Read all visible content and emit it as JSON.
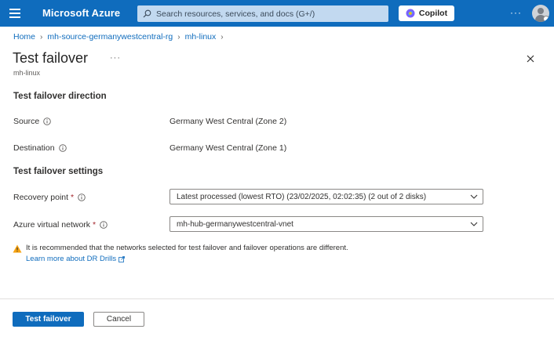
{
  "topbar": {
    "brand": "Microsoft Azure",
    "search_placeholder": "Search resources, services, and docs (G+/)",
    "copilot_label": "Copilot",
    "more_label": "···"
  },
  "breadcrumb": [
    {
      "label": "Home"
    },
    {
      "label": "mh-source-germanywestcentral-rg"
    },
    {
      "label": "mh-linux"
    }
  ],
  "page": {
    "title": "Test failover",
    "more": "···",
    "subtitle": "mh-linux"
  },
  "direction": {
    "heading": "Test failover direction",
    "source_label": "Source",
    "source_value": "Germany West Central (Zone 2)",
    "destination_label": "Destination",
    "destination_value": "Germany West Central (Zone 1)"
  },
  "settings": {
    "heading": "Test failover settings",
    "recovery_point_label": "Recovery point",
    "recovery_point_value": "Latest processed (lowest RTO) (23/02/2025, 02:02:35) (2 out of 2 disks)",
    "vnet_label": "Azure virtual network",
    "vnet_value": "mh-hub-germanywestcentral-vnet",
    "required_marker": "*"
  },
  "warning": {
    "text": "It is recommended that the networks selected for test failover and failover operations are different.",
    "link": "Learn more about DR Drills"
  },
  "footer": {
    "primary_label": "Test failover",
    "cancel_label": "Cancel"
  },
  "colors": {
    "topbar": "#0f6cbd",
    "accent": "#0f6cbd",
    "required": "#a4262c",
    "warning": "#f7a311"
  }
}
